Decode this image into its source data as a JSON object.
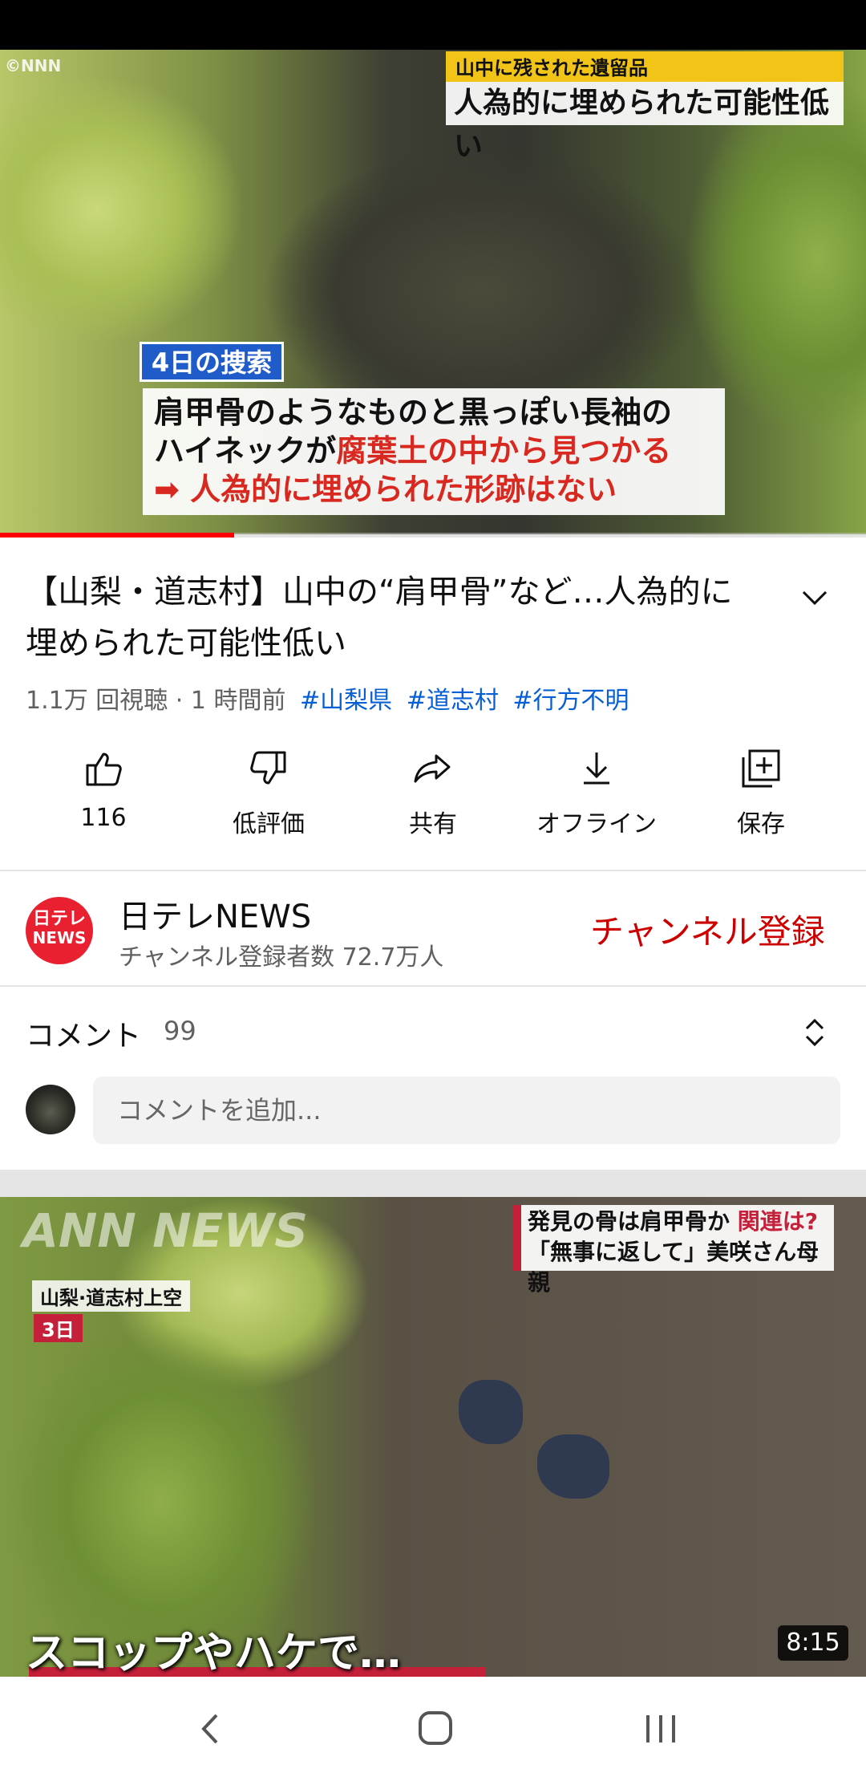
{
  "player": {
    "watermark": "©NNN",
    "caption_top_small": "山中に残された遺留品",
    "caption_top_big": "人為的に埋められた可能性低い",
    "search_tag": "4日の捜索",
    "caption_line1": "肩甲骨のようなものと黒っぽい長袖の",
    "caption_line2_black": "ハイネックが",
    "caption_line2_red": "腐葉土の中から見つかる",
    "caption_line3": "➡ 人為的に埋められた形跡はない",
    "progress": 0.27
  },
  "video": {
    "title": "【山梨・道志村】山中の“肩甲骨”など…人為的に埋められた可能性低い",
    "views_time": "1.1万 回視聴 · 1 時間前",
    "tags": [
      "#山梨県",
      "#道志村",
      "#行方不明"
    ]
  },
  "actions": {
    "like_count": "116",
    "dislike_label": "低評価",
    "share_label": "共有",
    "offline_label": "オフライン",
    "save_label": "保存"
  },
  "channel": {
    "avatar_line1": "日テレ",
    "avatar_line2": "NEWS",
    "name": "日テレNEWS",
    "subscribers": "チャンネル登録者数 72.7万人",
    "subscribe_label": "チャンネル登録"
  },
  "comments": {
    "label": "コメント",
    "count": "99",
    "input_placeholder": "コメントを追加..."
  },
  "next_video": {
    "watermark": "ANN NEWS",
    "location": "山梨·道志村上空",
    "day": "3日",
    "headline_part1": "発見の骨は肩甲骨か ",
    "headline_red": "関連は?",
    "headline_line2": "「無事に返して」美咲さん母親",
    "bottom_caption": "スコップやハケで…",
    "duration": "8:15"
  },
  "colors": {
    "accent_red": "#ff0000",
    "subscribe_red": "#cc0000",
    "link_blue": "#065fd4"
  }
}
